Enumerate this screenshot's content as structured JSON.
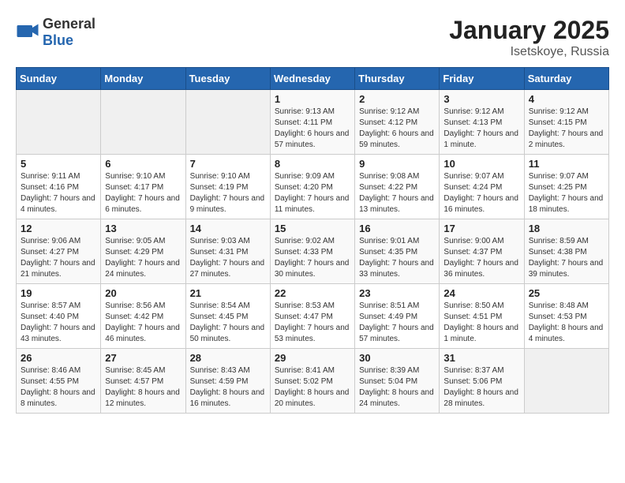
{
  "header": {
    "logo_general": "General",
    "logo_blue": "Blue",
    "month": "January 2025",
    "location": "Isetskoye, Russia"
  },
  "days_of_week": [
    "Sunday",
    "Monday",
    "Tuesday",
    "Wednesday",
    "Thursday",
    "Friday",
    "Saturday"
  ],
  "weeks": [
    [
      {
        "day": "",
        "info": ""
      },
      {
        "day": "",
        "info": ""
      },
      {
        "day": "",
        "info": ""
      },
      {
        "day": "1",
        "info": "Sunrise: 9:13 AM\nSunset: 4:11 PM\nDaylight: 6 hours and 57 minutes."
      },
      {
        "day": "2",
        "info": "Sunrise: 9:12 AM\nSunset: 4:12 PM\nDaylight: 6 hours and 59 minutes."
      },
      {
        "day": "3",
        "info": "Sunrise: 9:12 AM\nSunset: 4:13 PM\nDaylight: 7 hours and 1 minute."
      },
      {
        "day": "4",
        "info": "Sunrise: 9:12 AM\nSunset: 4:15 PM\nDaylight: 7 hours and 2 minutes."
      }
    ],
    [
      {
        "day": "5",
        "info": "Sunrise: 9:11 AM\nSunset: 4:16 PM\nDaylight: 7 hours and 4 minutes."
      },
      {
        "day": "6",
        "info": "Sunrise: 9:10 AM\nSunset: 4:17 PM\nDaylight: 7 hours and 6 minutes."
      },
      {
        "day": "7",
        "info": "Sunrise: 9:10 AM\nSunset: 4:19 PM\nDaylight: 7 hours and 9 minutes."
      },
      {
        "day": "8",
        "info": "Sunrise: 9:09 AM\nSunset: 4:20 PM\nDaylight: 7 hours and 11 minutes."
      },
      {
        "day": "9",
        "info": "Sunrise: 9:08 AM\nSunset: 4:22 PM\nDaylight: 7 hours and 13 minutes."
      },
      {
        "day": "10",
        "info": "Sunrise: 9:07 AM\nSunset: 4:24 PM\nDaylight: 7 hours and 16 minutes."
      },
      {
        "day": "11",
        "info": "Sunrise: 9:07 AM\nSunset: 4:25 PM\nDaylight: 7 hours and 18 minutes."
      }
    ],
    [
      {
        "day": "12",
        "info": "Sunrise: 9:06 AM\nSunset: 4:27 PM\nDaylight: 7 hours and 21 minutes."
      },
      {
        "day": "13",
        "info": "Sunrise: 9:05 AM\nSunset: 4:29 PM\nDaylight: 7 hours and 24 minutes."
      },
      {
        "day": "14",
        "info": "Sunrise: 9:03 AM\nSunset: 4:31 PM\nDaylight: 7 hours and 27 minutes."
      },
      {
        "day": "15",
        "info": "Sunrise: 9:02 AM\nSunset: 4:33 PM\nDaylight: 7 hours and 30 minutes."
      },
      {
        "day": "16",
        "info": "Sunrise: 9:01 AM\nSunset: 4:35 PM\nDaylight: 7 hours and 33 minutes."
      },
      {
        "day": "17",
        "info": "Sunrise: 9:00 AM\nSunset: 4:37 PM\nDaylight: 7 hours and 36 minutes."
      },
      {
        "day": "18",
        "info": "Sunrise: 8:59 AM\nSunset: 4:38 PM\nDaylight: 7 hours and 39 minutes."
      }
    ],
    [
      {
        "day": "19",
        "info": "Sunrise: 8:57 AM\nSunset: 4:40 PM\nDaylight: 7 hours and 43 minutes."
      },
      {
        "day": "20",
        "info": "Sunrise: 8:56 AM\nSunset: 4:42 PM\nDaylight: 7 hours and 46 minutes."
      },
      {
        "day": "21",
        "info": "Sunrise: 8:54 AM\nSunset: 4:45 PM\nDaylight: 7 hours and 50 minutes."
      },
      {
        "day": "22",
        "info": "Sunrise: 8:53 AM\nSunset: 4:47 PM\nDaylight: 7 hours and 53 minutes."
      },
      {
        "day": "23",
        "info": "Sunrise: 8:51 AM\nSunset: 4:49 PM\nDaylight: 7 hours and 57 minutes."
      },
      {
        "day": "24",
        "info": "Sunrise: 8:50 AM\nSunset: 4:51 PM\nDaylight: 8 hours and 1 minute."
      },
      {
        "day": "25",
        "info": "Sunrise: 8:48 AM\nSunset: 4:53 PM\nDaylight: 8 hours and 4 minutes."
      }
    ],
    [
      {
        "day": "26",
        "info": "Sunrise: 8:46 AM\nSunset: 4:55 PM\nDaylight: 8 hours and 8 minutes."
      },
      {
        "day": "27",
        "info": "Sunrise: 8:45 AM\nSunset: 4:57 PM\nDaylight: 8 hours and 12 minutes."
      },
      {
        "day": "28",
        "info": "Sunrise: 8:43 AM\nSunset: 4:59 PM\nDaylight: 8 hours and 16 minutes."
      },
      {
        "day": "29",
        "info": "Sunrise: 8:41 AM\nSunset: 5:02 PM\nDaylight: 8 hours and 20 minutes."
      },
      {
        "day": "30",
        "info": "Sunrise: 8:39 AM\nSunset: 5:04 PM\nDaylight: 8 hours and 24 minutes."
      },
      {
        "day": "31",
        "info": "Sunrise: 8:37 AM\nSunset: 5:06 PM\nDaylight: 8 hours and 28 minutes."
      },
      {
        "day": "",
        "info": ""
      }
    ]
  ]
}
